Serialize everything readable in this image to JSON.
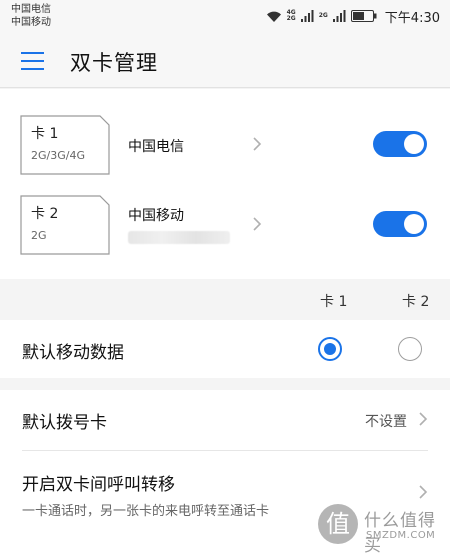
{
  "status_bar": {
    "carrier_1": "中国电信",
    "carrier_2": "中国移动",
    "net_tag_1": "4G",
    "net_tag_1b": "2G",
    "net_tag_2": "2G",
    "time": "下午4:30"
  },
  "header": {
    "title": "双卡管理"
  },
  "sims": [
    {
      "name": "卡 1",
      "networks": "2G/3G/4G",
      "carrier": "中国电信",
      "enabled": true
    },
    {
      "name": "卡 2",
      "networks": "2G",
      "carrier": "中国移动",
      "enabled": true
    }
  ],
  "columns": {
    "card1": "卡 1",
    "card2": "卡 2"
  },
  "default_data": {
    "label": "默认移动数据",
    "selected": "卡 1"
  },
  "default_dial": {
    "label": "默认拨号卡",
    "value": "不设置"
  },
  "call_forward": {
    "label": "开启双卡间呼叫转移",
    "description": "一卡通话时，另一张卡的来电呼转至通话卡"
  },
  "watermark": {
    "glyph": "值",
    "text": "什么值得买",
    "sub": "SMZDM.COM"
  },
  "colors": {
    "accent": "#1a73e8"
  }
}
